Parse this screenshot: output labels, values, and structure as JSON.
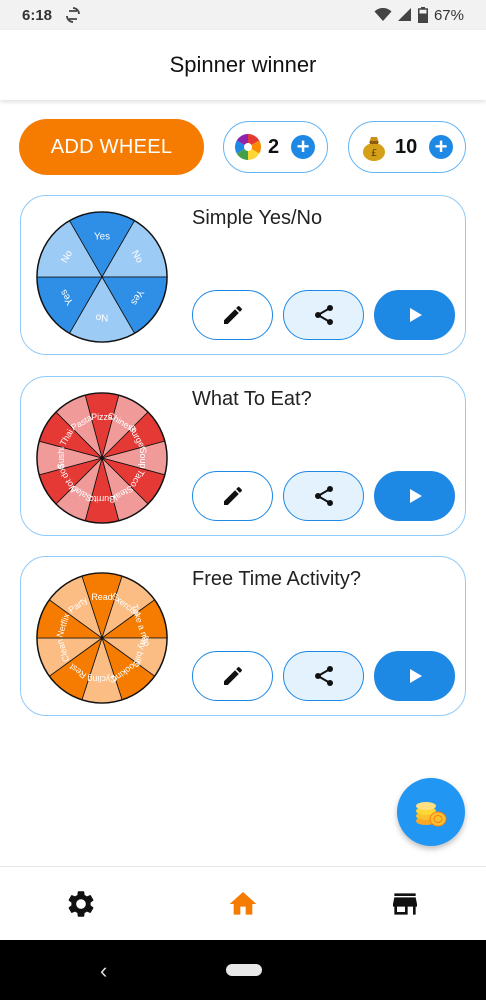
{
  "status_bar": {
    "time": "6:18",
    "battery": "67%"
  },
  "header": {
    "title": "Spinner winner"
  },
  "toolbar": {
    "add_wheel_label": "ADD WHEEL",
    "wheels_count": "2",
    "coins_count": "10"
  },
  "wheels": [
    {
      "name": "Simple Yes/No",
      "segments": [
        "Yes",
        "No",
        "Yes",
        "No",
        "Yes",
        "No"
      ],
      "colors": [
        "#2f8fe6",
        "#9ccbf5"
      ]
    },
    {
      "name": "What To Eat?",
      "segments": [
        "Pizza",
        "Chinese",
        "Burger",
        "Soup",
        "Taco",
        "Steak",
        "Burrito",
        "Salad",
        "Hot dog",
        "Sushi",
        "Thai",
        "Pasta"
      ],
      "colors": [
        "#e53935",
        "#f09a9a"
      ]
    },
    {
      "name": "Free Time Activity?",
      "segments": [
        "Read",
        "Exercise",
        "Take a nap",
        "Pay bills",
        "Cooking",
        "Cycling",
        "Rest",
        "Clean",
        "Netflix",
        "Party"
      ],
      "colors": [
        "#f57c00",
        "#fbbd84"
      ]
    }
  ],
  "colors": {
    "accent": "#1e88e5",
    "brand": "#f57c00"
  },
  "icons": {
    "edit": "pencil-icon",
    "share": "share-icon",
    "play": "play-icon",
    "settings": "gear-icon",
    "home": "home-icon",
    "store": "store-icon",
    "fab": "coins-icon"
  }
}
